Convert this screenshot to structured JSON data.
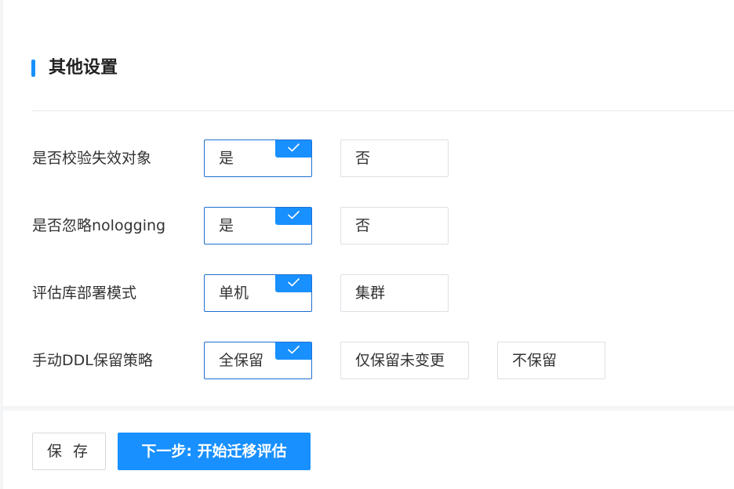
{
  "section": {
    "title": "其他设置"
  },
  "colors": {
    "accent": "#1890ff",
    "selected_border": "#1f6fd1"
  },
  "settings": [
    {
      "label": "是否校验失效对象",
      "options": [
        "是",
        "否"
      ],
      "selected": 0
    },
    {
      "label": "是否忽略nologging",
      "options": [
        "是",
        "否"
      ],
      "selected": 0
    },
    {
      "label": "评估库部署模式",
      "options": [
        "单机",
        "集群"
      ],
      "selected": 0
    },
    {
      "label": "手动DDL保留策略",
      "options": [
        "全保留",
        "仅保留未变更",
        "不保留"
      ],
      "selected": 0
    }
  ],
  "icons": {
    "selected_marker": "check-icon"
  },
  "footer": {
    "save_label": "保 存",
    "next_label": "下一步: 开始迁移评估"
  }
}
